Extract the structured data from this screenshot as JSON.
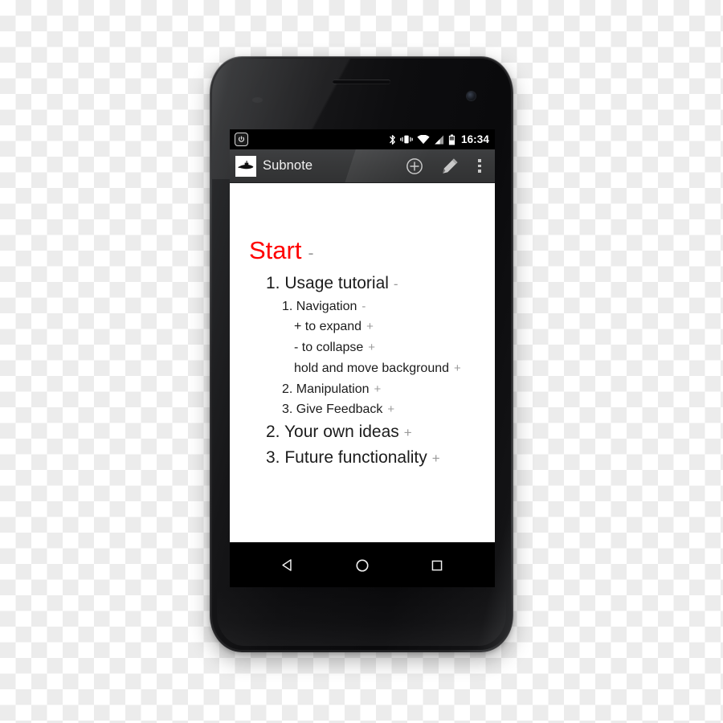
{
  "device": {
    "name": "android-phone-mockup",
    "earpiece": "earpiece-speaker",
    "front_camera": "front-camera"
  },
  "statusbar": {
    "power_icon": "power-icon",
    "icons": [
      {
        "name": "bluetooth-icon"
      },
      {
        "name": "vibrate-icon"
      },
      {
        "name": "wifi-icon"
      },
      {
        "name": "cell-signal-icon"
      },
      {
        "name": "battery-icon"
      }
    ],
    "time": "16:34"
  },
  "actionbar": {
    "logo_icon": "submarine-logo-icon",
    "title": "Subnote",
    "actions": [
      {
        "name": "add-node-button",
        "icon": "plus-circle-icon"
      },
      {
        "name": "edit-button",
        "icon": "pencil-icon"
      },
      {
        "name": "overflow-menu-button",
        "icon": "three-dots-icon"
      }
    ]
  },
  "note": {
    "nodes": [
      {
        "level": 0,
        "text": "Start",
        "marker": "-",
        "color": "#ff0000"
      },
      {
        "level": 1,
        "text": "1. Usage tutorial",
        "marker": "-"
      },
      {
        "level": 2,
        "text": "1. Navigation",
        "marker": "-"
      },
      {
        "level": 3,
        "text": "+ to expand",
        "marker": "+"
      },
      {
        "level": 3,
        "text": "- to collapse",
        "marker": "+"
      },
      {
        "level": 3,
        "text": "hold and move background",
        "marker": "+"
      },
      {
        "level": 2,
        "text": "2. Manipulation",
        "marker": "+"
      },
      {
        "level": 2,
        "text": "3. Give Feedback",
        "marker": "+"
      },
      {
        "level": 1,
        "text": "2. Your own ideas",
        "marker": "+"
      },
      {
        "level": 1,
        "text": "3. Future functionality",
        "marker": "+"
      }
    ]
  },
  "navbar": {
    "buttons": [
      {
        "name": "nav-back-button",
        "icon": "back-triangle-icon"
      },
      {
        "name": "nav-home-button",
        "icon": "home-circle-icon"
      },
      {
        "name": "nav-recents-button",
        "icon": "recents-square-icon"
      }
    ]
  },
  "colors": {
    "accent_red": "#ff0000",
    "marker_gray": "#9a9a9a",
    "actionbar": "#373839",
    "statusbar": "#000000",
    "screen": "#ffffff"
  }
}
